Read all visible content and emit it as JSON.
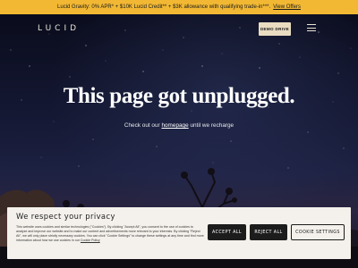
{
  "promo": {
    "text": "Lucid Gravity: 0% APR* + $10K Lucid Credit** + $3K allowance with qualifying trade-in***.",
    "link": "View Offers"
  },
  "nav": {
    "logo": "LUCID",
    "demo_drive": "DEMO DRIVE",
    "menu_icon": "hamburger-menu-icon"
  },
  "hero": {
    "headline": "This page got unplugged.",
    "sub_before": "Check out our",
    "sub_link": "homepage",
    "sub_after": "until we recharge"
  },
  "cookie": {
    "title": "We respect your privacy",
    "text": "This website uses cookies and similar technologies (\"Cookies\"). By clicking \"Accept All\", you consent to the use of cookies to analyze and improve our website and to make our content and advertisements more relevant to your interests. By clicking \"Reject All\", we will only place strictly necessary cookies. You can click \"Cookie Settings\" to change these settings at any time and find more information about how we use cookies in our",
    "policy_link": "Cookie Policy",
    "accept_all": "ACCEPT ALL",
    "reject_all": "REJECT ALL",
    "settings": "COOKIE SETTINGS"
  },
  "colors": {
    "promo_bg": "#f2b833",
    "demo_btn_bg": "#e9dcc1",
    "cookie_bg": "#f4f1ec",
    "dark_button": "#1c1c1c"
  }
}
